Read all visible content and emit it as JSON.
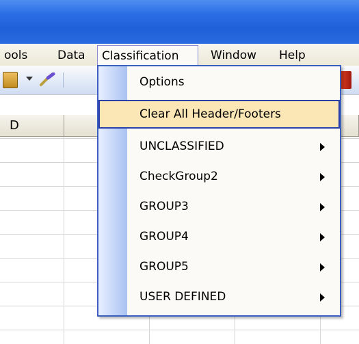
{
  "menubar": {
    "items": [
      {
        "label": "ools"
      },
      {
        "label": "Data"
      },
      {
        "label": "Classification"
      },
      {
        "label": "Window"
      },
      {
        "label": "Help"
      }
    ]
  },
  "sheet": {
    "column_header_d": "D"
  },
  "classification_menu": {
    "items": [
      {
        "label": "Options",
        "submenu": false
      },
      {
        "label": "Clear All Header/Footers",
        "submenu": false,
        "highlighted": true
      },
      {
        "label": "UNCLASSIFIED",
        "submenu": true
      },
      {
        "label": "CheckGroup2",
        "submenu": true
      },
      {
        "label": "GROUP3",
        "submenu": true
      },
      {
        "label": "GROUP4",
        "submenu": true
      },
      {
        "label": "GROUP5",
        "submenu": true
      },
      {
        "label": "USER DEFINED",
        "submenu": true
      }
    ]
  },
  "colors": {
    "title_bar": "#2d6fe6",
    "menu_highlight": "#fbe7b6",
    "menu_border": "#3a5fbf"
  }
}
